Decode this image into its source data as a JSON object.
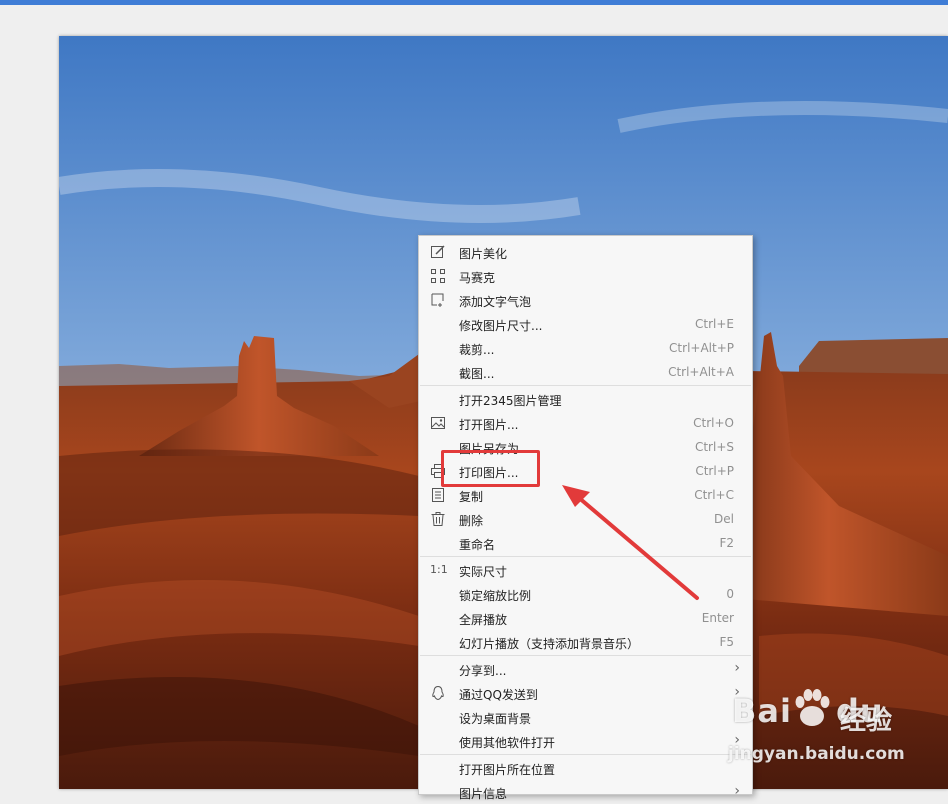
{
  "menu": {
    "items": [
      {
        "label": "图片美化",
        "shortcut": "",
        "icon": "edit-icon"
      },
      {
        "label": "马赛克",
        "shortcut": "",
        "icon": "mosaic-icon"
      },
      {
        "label": "添加文字气泡",
        "shortcut": "",
        "icon": "text-bubble-icon"
      },
      {
        "label": "修改图片尺寸...",
        "shortcut": "Ctrl+E"
      },
      {
        "label": "裁剪...",
        "shortcut": "Ctrl+Alt+P"
      },
      {
        "label": "截图...",
        "shortcut": "Ctrl+Alt+A"
      },
      {
        "label": "打开2345图片管理",
        "shortcut": ""
      },
      {
        "label": "打开图片...",
        "shortcut": "Ctrl+O",
        "icon": "image-icon"
      },
      {
        "label": "图片另存为...",
        "shortcut": "Ctrl+S"
      },
      {
        "label": "打印图片...",
        "shortcut": "Ctrl+P",
        "icon": "printer-icon"
      },
      {
        "label": "复制",
        "shortcut": "Ctrl+C",
        "icon": "copy-icon"
      },
      {
        "label": "删除",
        "shortcut": "Del",
        "icon": "trash-icon"
      },
      {
        "label": "重命名",
        "shortcut": "F2"
      },
      {
        "label": "实际尺寸",
        "shortcut": "",
        "icon_text": "1:1"
      },
      {
        "label": "锁定缩放比例",
        "shortcut": "0"
      },
      {
        "label": "全屏播放",
        "shortcut": "Enter"
      },
      {
        "label": "幻灯片播放（支持添加背景音乐）",
        "shortcut": "F5"
      },
      {
        "label": "分享到...",
        "shortcut": "",
        "submenu": true
      },
      {
        "label": "通过QQ发送到",
        "shortcut": "",
        "submenu": true,
        "icon": "qq-icon"
      },
      {
        "label": "设为桌面背景",
        "shortcut": ""
      },
      {
        "label": "使用其他软件打开",
        "shortcut": "",
        "submenu": true
      },
      {
        "label": "打开图片所在位置",
        "shortcut": ""
      },
      {
        "label": "图片信息",
        "shortcut": "",
        "submenu": true
      }
    ],
    "submenu_arrow": "›"
  },
  "watermark": {
    "brand": "Bai",
    "brand_suffix": "du",
    "chinese": "经验",
    "url": "jingyan.baidu.com"
  },
  "colors": {
    "title_strip": "#3f7dd6",
    "highlight": "#e23a3a",
    "menu_bg": "#f7f7f7"
  }
}
